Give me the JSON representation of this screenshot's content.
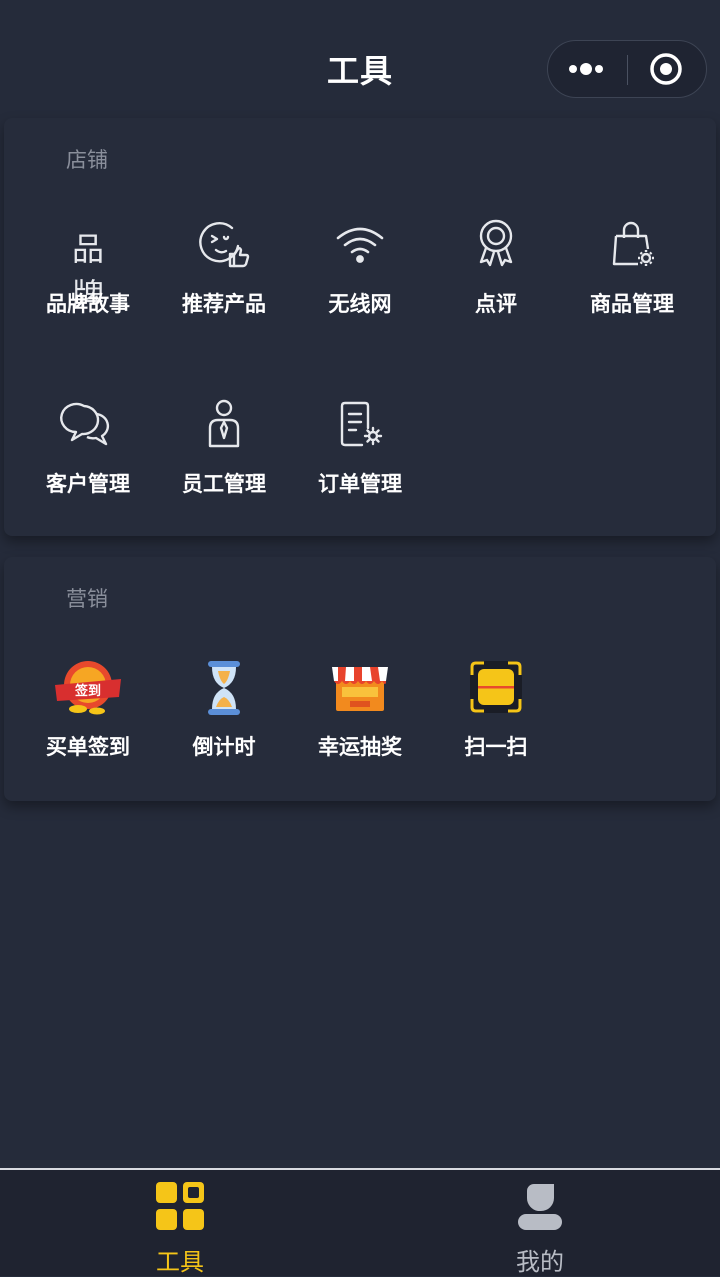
{
  "nav": {
    "title": "工具"
  },
  "shop": {
    "title": "店铺",
    "items": [
      {
        "label": "品牌故事",
        "icon": "brand-icon",
        "glyph": "品牌"
      },
      {
        "label": "推荐产品",
        "icon": "recommend-thumbs-up-icon"
      },
      {
        "label": "无线网",
        "icon": "wifi-icon"
      },
      {
        "label": "点评",
        "icon": "award-ribbon-icon"
      },
      {
        "label": "商品管理",
        "icon": "shopping-bag-gear-icon"
      },
      {
        "label": "客户管理",
        "icon": "chat-bubbles-icon"
      },
      {
        "label": "员工管理",
        "icon": "staff-person-icon"
      },
      {
        "label": "订单管理",
        "icon": "order-document-gear-icon"
      }
    ]
  },
  "marketing": {
    "title": "营销",
    "items": [
      {
        "label": "买单签到",
        "icon": "checkin-badge-icon",
        "badge": "签到"
      },
      {
        "label": "倒计时",
        "icon": "hourglass-icon"
      },
      {
        "label": "幸运抽奖",
        "icon": "lucky-draw-stall-icon"
      },
      {
        "label": "扫一扫",
        "icon": "scan-icon"
      }
    ]
  },
  "tabbar": {
    "items": [
      {
        "label": "工具",
        "icon": "grid-apps-icon",
        "active": true
      },
      {
        "label": "我的",
        "icon": "user-profile-icon",
        "active": false
      }
    ]
  },
  "colors": {
    "background": "#252b3a",
    "accent_yellow": "#f5c518",
    "tab_inactive": "#b8bcc5"
  }
}
